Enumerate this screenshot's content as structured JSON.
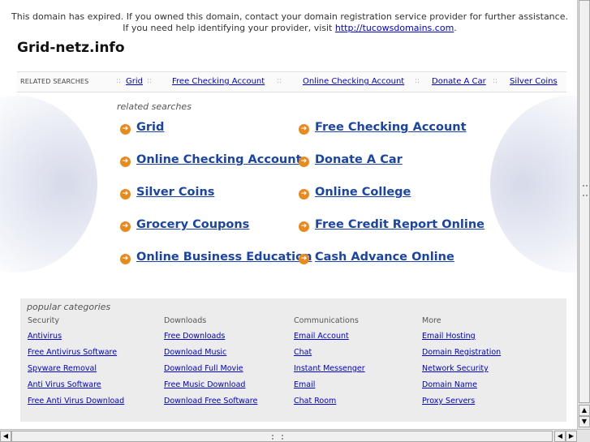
{
  "notice": {
    "text": "This domain has expired. If you owned this domain, contact your domain registration service provider for further assistance. If you need help identifying your provider, visit ",
    "link": "http://tucowsdomains.com",
    "end": "."
  },
  "site_title": "Grid-netz.info",
  "related_bar": {
    "label": "RELATED SEARCHES",
    "separator": "::",
    "links": [
      "Grid",
      "Free Checking Account",
      "Online Checking Account",
      "Donate A Car",
      "Silver Coins"
    ]
  },
  "related_searches": {
    "heading": "related searches",
    "arrow_glyph": "➜",
    "left": [
      "Grid",
      "Online Checking Account",
      "Silver Coins",
      "Grocery Coupons",
      "Online Business Education"
    ],
    "right": [
      "Free Checking Account",
      "Donate A Car",
      "Online College",
      "Free Credit Report Online",
      "Cash Advance Online"
    ]
  },
  "popular": {
    "heading": "popular categories",
    "columns": [
      {
        "title": "Security",
        "links": [
          "Antivirus",
          "Free Antivirus Software",
          "Spyware Removal",
          "Anti Virus Software",
          "Free Anti Virus Download"
        ]
      },
      {
        "title": "Downloads",
        "links": [
          "Free Downloads",
          "Download Music",
          "Download Full Movie",
          "Free Music Download",
          "Download Free Software"
        ]
      },
      {
        "title": "Communications",
        "links": [
          "Email Account",
          "Chat",
          "Instant Messenger",
          "Email",
          "Chat Room"
        ]
      },
      {
        "title": "More",
        "links": [
          "Email Hosting",
          "Domain Registration",
          "Network Security",
          "Domain Name",
          "Proxy Servers"
        ]
      }
    ]
  },
  "scrollbars": {
    "up": "▲",
    "down": "▼",
    "left": "◀",
    "right": "▶"
  },
  "colors": {
    "link": "#1a44a8",
    "arrow": "#e98a1d",
    "panel": "#ececec"
  }
}
